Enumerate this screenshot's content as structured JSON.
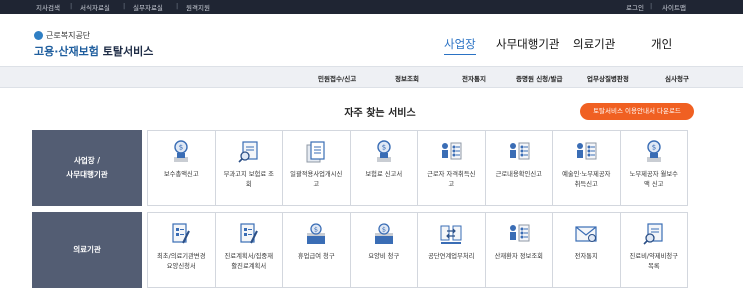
{
  "topbar": {
    "left_links": [
      "지사검색",
      "서식자료실",
      "실무자료실",
      "원격지원"
    ],
    "right_links": [
      "로그인",
      "사이트맵"
    ]
  },
  "logo": {
    "org": "근로복지공단",
    "service_prefix": "고용·산재보험",
    "service_suffix": "토탈서비스"
  },
  "main_nav": [
    "사업장",
    "사무대행기관",
    "의료기관",
    "개인"
  ],
  "sub_nav": [
    "민원접수/신고",
    "정보조회",
    "전자통지",
    "증명원 신청/발급",
    "업무상질병판정",
    "심사청구"
  ],
  "section": {
    "title": "자주 찾는 서비스",
    "download_button": "토탈서비스 이용안내서 다운로드"
  },
  "categories": [
    {
      "label": "사업장 /\n사무대행기관",
      "services": [
        {
          "label": "보수총액신고",
          "icon": "coin-bag-icon"
        },
        {
          "label": "부과고지 보험료 조\n회",
          "icon": "document-search-icon"
        },
        {
          "label": "일괄적용사업개시신\n고",
          "icon": "document-stack-icon"
        },
        {
          "label": "보험료 신고서",
          "icon": "coin-bag-icon"
        },
        {
          "label": "근로자 자격취득신\n고",
          "icon": "worker-chart-icon"
        },
        {
          "label": "근로내용확인신고",
          "icon": "worker-chart-icon"
        },
        {
          "label": "예술인·노무제공자\n취득신고",
          "icon": "worker-chart-icon"
        },
        {
          "label": "노무제공자 월보수\n액 신고",
          "icon": "coin-bag-icon"
        }
      ]
    },
    {
      "label": "의료기관",
      "services": [
        {
          "label": "최초/의료기관변경\n요양신청서",
          "icon": "document-pen-icon"
        },
        {
          "label": "진료계획서/집중재\n활진료계획서",
          "icon": "document-pen-icon"
        },
        {
          "label": "휴업급여 청구",
          "icon": "coin-box-icon"
        },
        {
          "label": "요양비 청구",
          "icon": "coin-box-icon"
        },
        {
          "label": "공단연계업무처리",
          "icon": "exchange-icon"
        },
        {
          "label": "산재환자 정보조회",
          "icon": "worker-chart-icon"
        },
        {
          "label": "전자통지",
          "icon": "envelope-icon"
        },
        {
          "label": "진료비/약제비청구\n목록",
          "icon": "document-search-icon"
        }
      ]
    }
  ],
  "colors": {
    "topbar": "#1f2533",
    "brand_blue": "#2a72c4",
    "category_bg": "#535d73",
    "download_button": "#f06022"
  }
}
